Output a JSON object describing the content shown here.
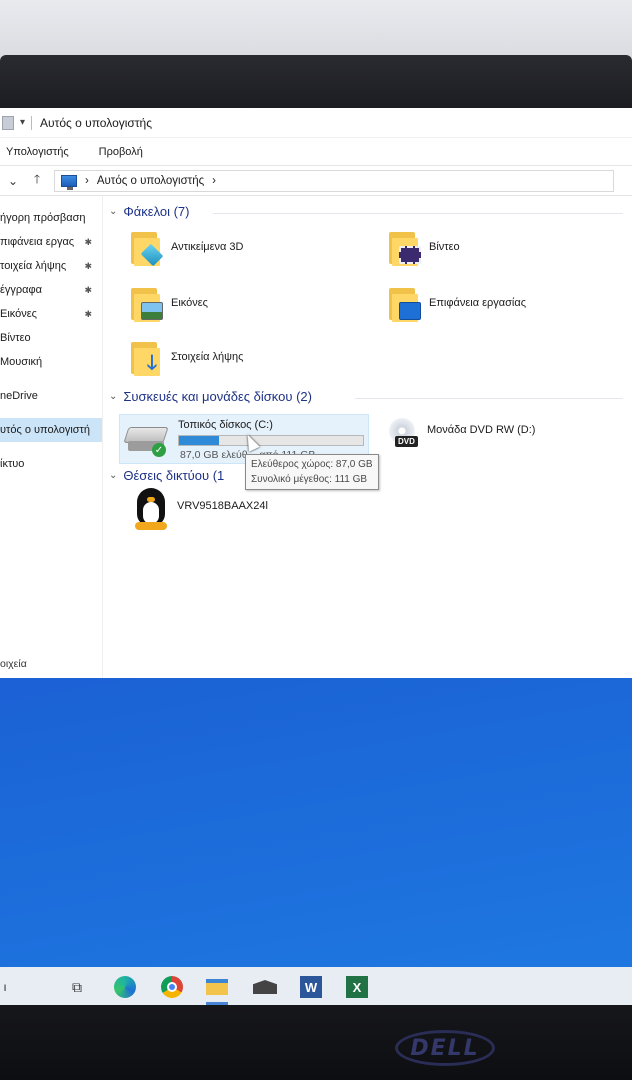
{
  "window": {
    "title": "Αυτός ο υπολογιστής",
    "ribbon_tabs": [
      "Υπολογιστής",
      "Προβολή"
    ],
    "address": "Αυτός ο υπολογιστής"
  },
  "sidebar": {
    "items": [
      {
        "label": "ήγορη πρόσβαση",
        "pinned": false
      },
      {
        "label": "πιφάνεια εργας",
        "pinned": true
      },
      {
        "label": "τοιχεία λήψης",
        "pinned": true
      },
      {
        "label": "έγγραφα",
        "pinned": true
      },
      {
        "label": "Εικόνες",
        "pinned": true
      },
      {
        "label": "Βίντεο",
        "pinned": false
      },
      {
        "label": "Μουσική",
        "pinned": false
      },
      {
        "label": "neDrive",
        "pinned": false
      },
      {
        "label": "υτός ο υπολογιστή",
        "pinned": false,
        "active": true
      },
      {
        "label": "ίκτυο",
        "pinned": false
      }
    ],
    "status": "οιχεία",
    "pin_glyph": "✱"
  },
  "content": {
    "folders_header": "Φάκελοι (7)",
    "folders": [
      {
        "label": "Αντικείμενα 3D",
        "icon": "objects-3d-icon"
      },
      {
        "label": "Βίντεο",
        "icon": "videos-icon"
      },
      {
        "label": "Εικόνες",
        "icon": "pictures-icon"
      },
      {
        "label": "Επιφάνεια εργασίας",
        "icon": "desktop-icon"
      },
      {
        "label": "Στοιχεία λήψης",
        "icon": "downloads-icon"
      }
    ],
    "devices_header": "Συσκευές και μονάδες δίσκου (2)",
    "drive_c": {
      "name": "Τοπικός δίσκος (C:)",
      "used_fraction": 0.22,
      "free_text": "87,0 GB ελεύθ... από 111 GB"
    },
    "dvd": {
      "name": "Μονάδα DVD RW (D:)",
      "badge": "DVD"
    },
    "tooltip": {
      "free": "Ελεύθερος χώρος: 87,0 GB",
      "total": "Συνολικό μέγεθος: 111 GB"
    },
    "network_header": "Θέσεις δικτύου (1",
    "network_item": "VRV9518BAAX24l"
  },
  "monitor_brand": "DELL",
  "colors": {
    "group_header": "#1e3287",
    "selection": "#cce4f7",
    "drive_fill": "#2f8ad8",
    "desktop": "#2353d8"
  }
}
